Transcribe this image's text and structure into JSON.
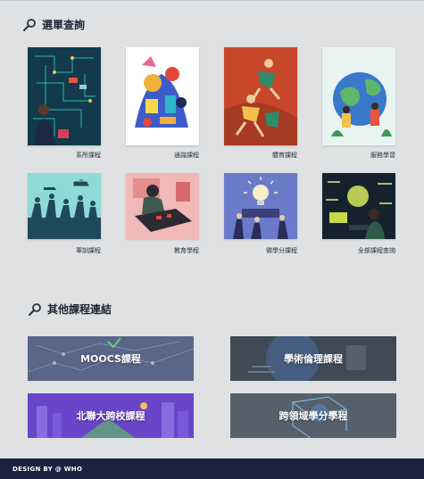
{
  "section_menu": {
    "title": "選單查詢",
    "icon": "search-icon"
  },
  "menu_items": [
    {
      "label": "系所課程"
    },
    {
      "label": "通識課程"
    },
    {
      "label": "體育課程"
    },
    {
      "label": "服務學習"
    },
    {
      "label": "軍訓課程"
    },
    {
      "label": "教育學程"
    },
    {
      "label": "微學分課程"
    },
    {
      "label": "全部課程查詢"
    }
  ],
  "section_links": {
    "title": "其他課程連結",
    "icon": "search-icon"
  },
  "banners": [
    {
      "label": "MOOCS課程"
    },
    {
      "label": "學術倫理課程"
    },
    {
      "label": "北聯大跨校課程"
    },
    {
      "label": "跨領域學分學程"
    }
  ],
  "footer": {
    "text": "DESIGN BY @ WHO"
  }
}
